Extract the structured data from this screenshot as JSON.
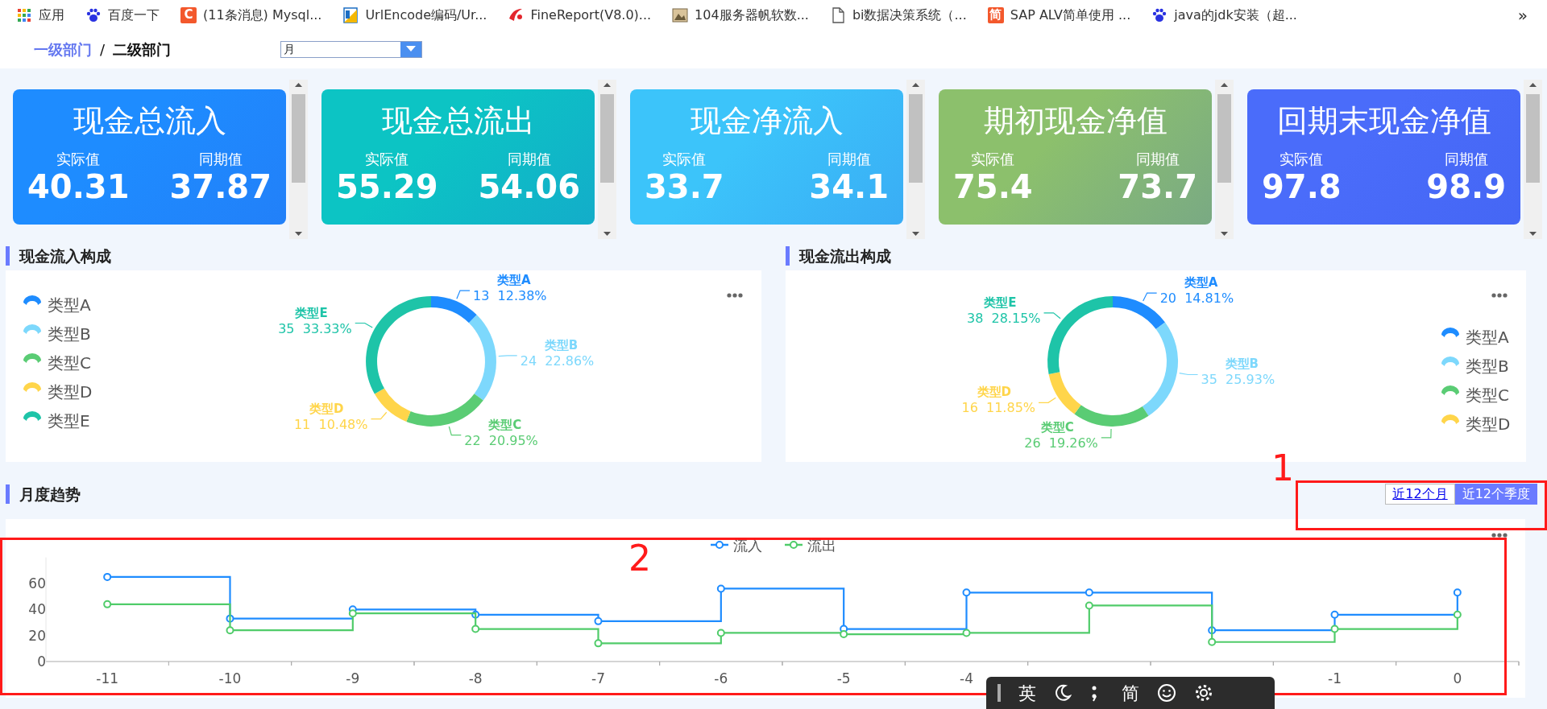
{
  "bookmarks": [
    {
      "label": "应用"
    },
    {
      "label": "百度一下"
    },
    {
      "icon_text": "C",
      "label": "(11条消息) Mysql..."
    },
    {
      "label": "UrlEncode编码/Ur..."
    },
    {
      "label": "FineReport(V8.0)..."
    },
    {
      "label": "104服务器帆软数..."
    },
    {
      "label": "bi数据决策系统（..."
    },
    {
      "icon_text": "简",
      "label": "SAP ALV简单使用 ..."
    },
    {
      "label": "java的jdk安装（超..."
    }
  ],
  "bookmarks_more": "»",
  "breadcrumb": {
    "items": [
      {
        "label": "一级部门",
        "selected": false
      },
      {
        "label": "二级部门",
        "selected": true
      }
    ],
    "separator": "/"
  },
  "period_select": {
    "value": "月"
  },
  "kpis": [
    {
      "title": "现金总流入",
      "actual_label": "实际值",
      "actual": "40.31",
      "prior_label": "同期值",
      "prior": "37.87",
      "color": "#1e8cff"
    },
    {
      "title": "现金总流出",
      "actual_label": "实际值",
      "actual": "55.29",
      "prior_label": "同期值",
      "prior": "54.06",
      "color": "#0cc4c4"
    },
    {
      "title": "现金净流入",
      "actual_label": "实际值",
      "actual": "33.7",
      "prior_label": "同期值",
      "prior": "34.1",
      "color": "#3cc4fa"
    },
    {
      "title": "期初现金净值",
      "actual_label": "实际值",
      "actual": "75.4",
      "prior_label": "同期值",
      "prior": "73.7",
      "color": "#8cc06c"
    },
    {
      "title": "回期末现金净值",
      "actual_label": "实际值",
      "actual": "97.8",
      "prior_label": "同期值",
      "prior": "98.9",
      "color": "#4a6cfa"
    }
  ],
  "composition_panels": [
    {
      "title": "现金流入构成",
      "legend": [
        "类型A",
        "类型B",
        "类型C",
        "类型D",
        "类型E"
      ],
      "chart_data": {
        "type": "donut",
        "categories": [
          "类型A",
          "类型B",
          "类型C",
          "类型D",
          "类型E"
        ],
        "values": [
          13,
          24,
          22,
          11,
          35
        ],
        "colors": [
          "#1e8cff",
          "#7dd8fc",
          "#5acc74",
          "#ffd54a",
          "#1ec4a8"
        ],
        "value_labels": [
          "13  12.38%",
          "24  22.86%",
          "22  20.95%",
          "11  10.48%",
          "35  33.33%"
        ]
      }
    },
    {
      "title": "现金流出构成",
      "legend": [
        "类型A",
        "类型B",
        "类型C",
        "类型D"
      ],
      "chart_data": {
        "type": "donut",
        "categories": [
          "类型A",
          "类型B",
          "类型C",
          "类型D",
          "类型E"
        ],
        "values": [
          20,
          35,
          26,
          16,
          38
        ],
        "colors": [
          "#1e8cff",
          "#7dd8fc",
          "#5acc74",
          "#ffd54a",
          "#1ec4a8"
        ],
        "value_labels": [
          "20  14.81%",
          "35  25.93%",
          "26  19.26%",
          "16  11.85%",
          "38  28.15%"
        ]
      }
    }
  ],
  "trend": {
    "title": "月度趋势",
    "range_buttons": [
      {
        "label": "近12个月",
        "selected": false
      },
      {
        "label": "近12个季度",
        "selected": true
      }
    ],
    "chart_data": {
      "type": "line",
      "x": [
        -11,
        -10,
        -10,
        -9,
        -9,
        -8,
        -8,
        -7,
        -7,
        -6,
        -6,
        -5,
        -5,
        -4,
        -4,
        -3,
        -3,
        -2,
        -2,
        -1,
        -1,
        0,
        0
      ],
      "xlim": [
        -11.5,
        0.5
      ],
      "ylim": [
        0,
        80
      ],
      "xticks": [
        -11,
        -10,
        -9,
        -8,
        -7,
        -6,
        -5,
        -4,
        -1,
        0
      ],
      "yticks": [
        0,
        20,
        40,
        60
      ],
      "legend": true,
      "series": [
        {
          "name": "流入",
          "color": "#1e8cff",
          "values": [
            65,
            65,
            33,
            33,
            40,
            40,
            36,
            36,
            31,
            31,
            56,
            56,
            25,
            25,
            53,
            53,
            53,
            53,
            24,
            24,
            36,
            36,
            53
          ]
        },
        {
          "name": "流出",
          "color": "#50cc6a",
          "values": [
            44,
            44,
            24,
            24,
            37,
            37,
            25,
            25,
            14,
            14,
            22,
            22,
            21,
            21,
            22,
            22,
            43,
            43,
            15,
            15,
            25,
            25,
            36
          ]
        }
      ]
    }
  },
  "annotations": [
    {
      "label": "1"
    },
    {
      "label": "2"
    }
  ],
  "ime_toolbar": {
    "language": "英",
    "charset": "简"
  }
}
